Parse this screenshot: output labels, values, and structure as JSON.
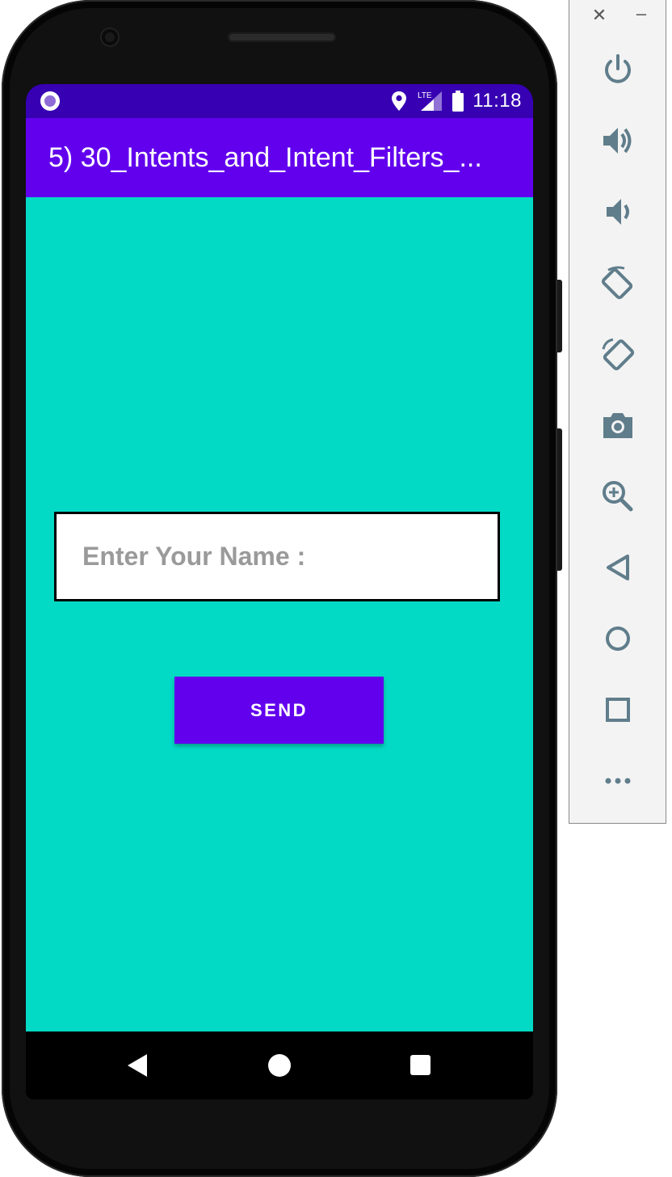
{
  "status_bar": {
    "time": "11:18",
    "network": "LTE",
    "icons": [
      "notification-dot-icon",
      "location-icon",
      "lte-signal-icon",
      "battery-icon"
    ]
  },
  "app_bar": {
    "title": "5) 30_Intents_and_Intent_Filters_..."
  },
  "form": {
    "name_placeholder": "Enter Your Name :",
    "name_value": "",
    "send_label": "SEND"
  },
  "nav_bar": {
    "icons": [
      "back-icon",
      "home-icon",
      "recents-icon"
    ]
  },
  "emulator_toolbar": {
    "window_controls": [
      "close-icon",
      "minimize-icon"
    ],
    "close_glyph": "✕",
    "minimize_glyph": "–",
    "buttons": [
      "power-icon",
      "volume-up-icon",
      "volume-down-icon",
      "rotate-left-icon",
      "rotate-right-icon",
      "camera-icon",
      "zoom-icon",
      "back-icon",
      "home-icon",
      "overview-icon",
      "more-icon"
    ]
  },
  "colors": {
    "status_bar": "#3700b3",
    "app_bar": "#6200ee",
    "content_background": "#03dac5",
    "button": "#6200ee",
    "toolbar_icon": "#607d8b"
  }
}
